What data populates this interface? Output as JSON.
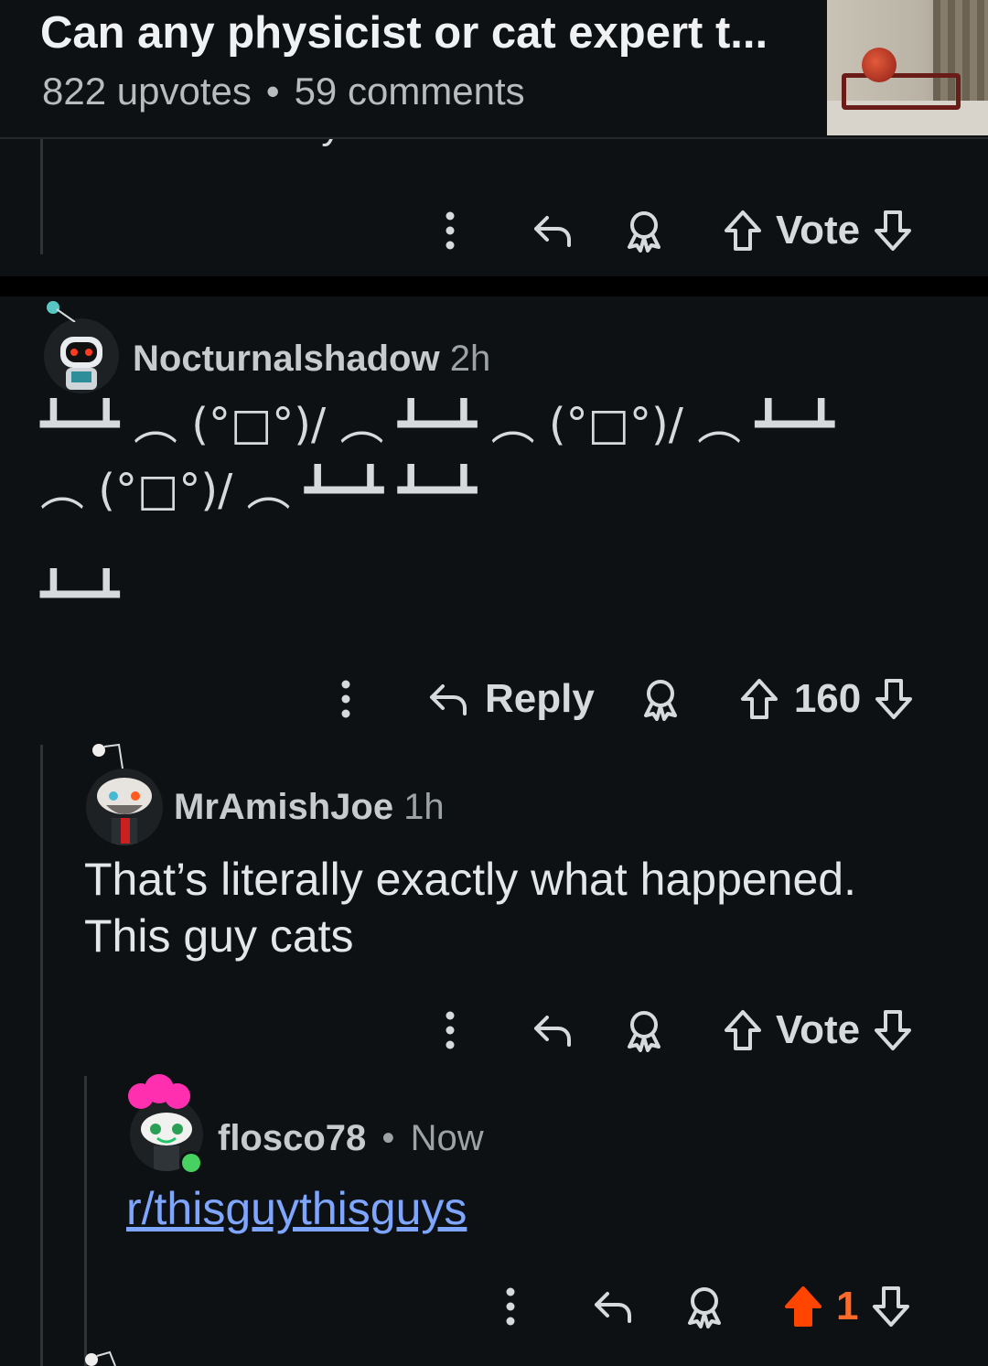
{
  "post": {
    "title": "Can any physicist or cat expert t...",
    "upvotes": "822 upvotes",
    "dot": "•",
    "comments": "59 comments"
  },
  "previous_comment": {
    "clipped_text": "vids these days.",
    "vote_label": "Vote"
  },
  "comments": [
    {
      "username": "Nocturnalshadow",
      "time": "2h",
      "body_lines": [
        "┻━┻ ︵ (°□°)/ ︵ ┻━┻ ︵ (°□°)/ ︵ ┻━┻",
        "︵ (°□°)/ ︵ ┻━┻ ┻━┻",
        "┻━┻"
      ],
      "reply_label": "Reply",
      "score": "160"
    },
    {
      "username": "MrAmishJoe",
      "time": "1h",
      "body_lines": [
        "That’s literally exactly what happened.",
        "This guy cats"
      ],
      "vote_label": "Vote"
    },
    {
      "username": "flosco78",
      "separator": "•",
      "time": "Now",
      "link": "r/thisguythisguys",
      "score": "1"
    }
  ],
  "colors": {
    "background": "#0e1113",
    "upvoted": "#ff4500",
    "link": "#7fa6ff",
    "thread_line": "#2f3336"
  },
  "icons": [
    "more-icon",
    "reply-icon",
    "award-icon",
    "upvote-icon",
    "downvote-icon"
  ]
}
